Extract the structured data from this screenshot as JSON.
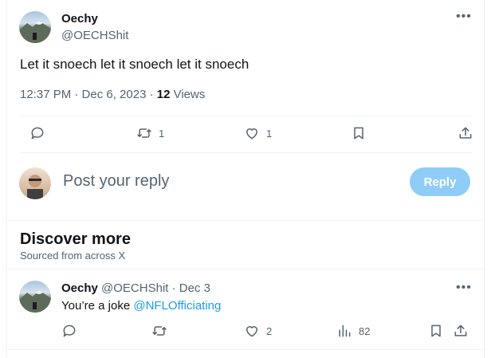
{
  "tweet": {
    "author_name": "Oechy",
    "author_handle": "@OECHShit",
    "text": "Let it snoech let it snoech let it snoech",
    "time": "12:37 PM · Dec 6, 2023 · ",
    "views_count": "12",
    "views_label": " Views",
    "retweets": "1",
    "likes": "1"
  },
  "reply_box": {
    "placeholder": "Post your reply",
    "button": "Reply"
  },
  "discover": {
    "title": "Discover more",
    "subtitle": "Sourced from across X"
  },
  "post2": {
    "author_name": "Oechy",
    "meta": " @OECHShit · Dec 3",
    "text": "You’re a joke ",
    "mention": "@NFLOfficiating",
    "likes": "2",
    "views": "82"
  },
  "more_label": "•••",
  "colors": {
    "accent": "#1d9bf0",
    "reply_button": "#8ecdf8",
    "muted": "#536471"
  }
}
